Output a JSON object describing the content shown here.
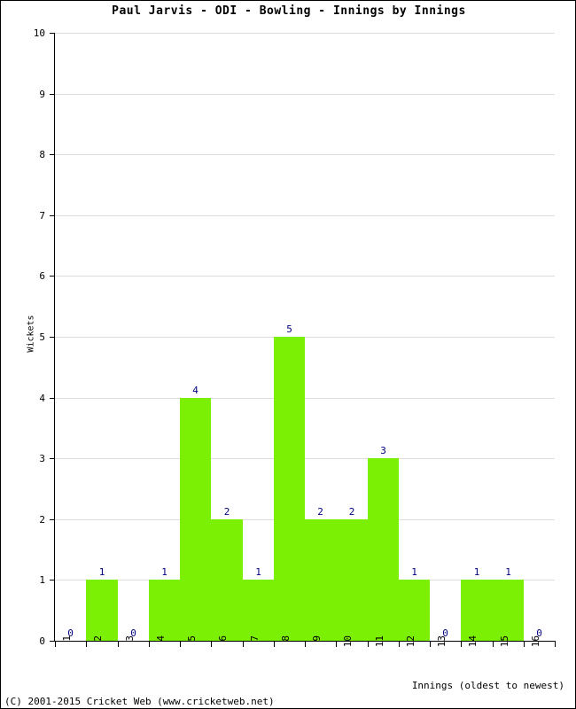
{
  "chart_data": {
    "type": "bar",
    "title": "Paul Jarvis - ODI - Bowling - Innings by Innings",
    "xlabel": "Innings (oldest to newest)",
    "ylabel": "Wickets",
    "categories": [
      "1",
      "2",
      "3",
      "4",
      "5",
      "6",
      "7",
      "8",
      "9",
      "10",
      "11",
      "12",
      "13",
      "14",
      "15",
      "16"
    ],
    "values": [
      0,
      1,
      0,
      1,
      4,
      2,
      1,
      5,
      2,
      2,
      3,
      1,
      0,
      1,
      1,
      0
    ],
    "data_labels": [
      "0",
      "1",
      "0",
      "1",
      "4",
      "2",
      "1",
      "5",
      "2",
      "2",
      "3",
      "1",
      "0",
      "1",
      "1",
      "0"
    ],
    "ylim": [
      0,
      10
    ],
    "y_ticks": [
      "0",
      "1",
      "2",
      "3",
      "4",
      "5",
      "6",
      "7",
      "8",
      "9",
      "10"
    ],
    "grid": true,
    "legend": "none",
    "bar_color": "#7cf004",
    "label_color": "#000080",
    "grid_color": "#dcdcdc",
    "axis_color": "#000000"
  },
  "footer": {
    "copyright": "(C) 2001-2015 Cricket Web (www.cricketweb.net)"
  }
}
